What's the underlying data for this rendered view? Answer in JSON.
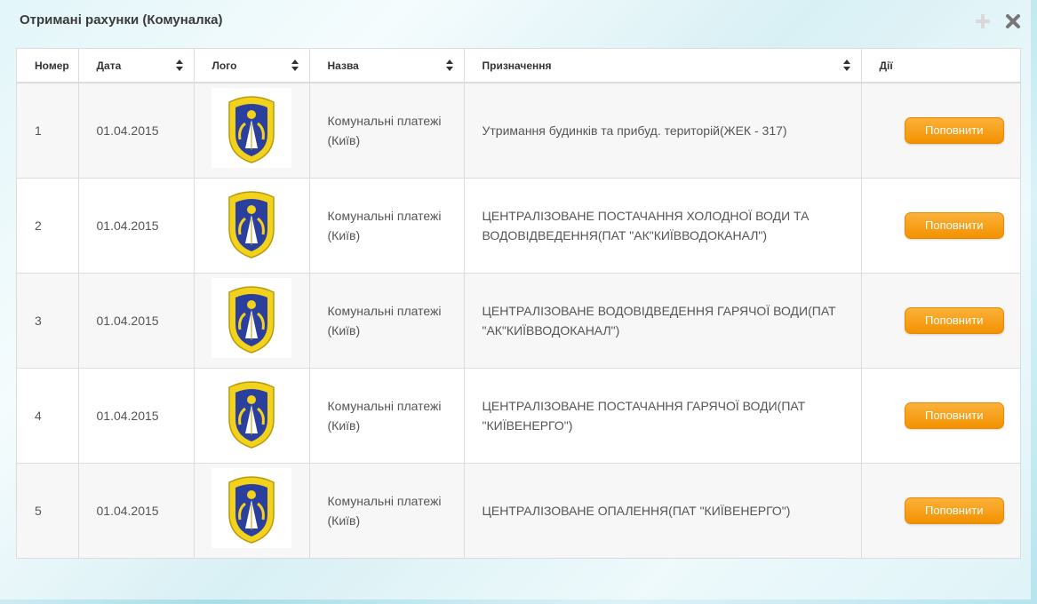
{
  "panel": {
    "title": "Отримані рахунки (Комуналка)",
    "add_icon": "plus-icon",
    "close_icon": "close-icon"
  },
  "table": {
    "headers": {
      "number": "Номер",
      "date": "Дата",
      "logo": "Лого",
      "name": "Назва",
      "purpose": "Призначення",
      "actions": "Дії"
    },
    "rows": [
      {
        "number": "1",
        "date": "01.04.2015",
        "logo": "kyiv-coat-of-arms-icon",
        "name": "Комунальні платежі (Київ)",
        "purpose": "Утримання будинків та прибуд. територій(ЖЕК - 317)",
        "action": "Поповнити"
      },
      {
        "number": "2",
        "date": "01.04.2015",
        "logo": "kyiv-coat-of-arms-icon",
        "name": "Комунальні платежі (Київ)",
        "purpose": "ЦЕНТРАЛІЗОВАНЕ ПОСТАЧАННЯ ХОЛОДНОЇ ВОДИ ТА ВОДОВІДВЕДЕННЯ(ПАТ \"АК\"КИЇВВОДОКАНАЛ\")",
        "action": "Поповнити"
      },
      {
        "number": "3",
        "date": "01.04.2015",
        "logo": "kyiv-coat-of-arms-icon",
        "name": "Комунальні платежі (Київ)",
        "purpose": "ЦЕНТРАЛІЗОВАНЕ ВОДОВІДВЕДЕННЯ ГАРЯЧОЇ ВОДИ(ПАТ \"АК\"КИЇВВОДОКАНАЛ\")",
        "action": "Поповнити"
      },
      {
        "number": "4",
        "date": "01.04.2015",
        "logo": "kyiv-coat-of-arms-icon",
        "name": "Комунальні платежі (Київ)",
        "purpose": "ЦЕНТРАЛІЗОВАНЕ ПОСТАЧАННЯ ГАРЯЧОЇ ВОДИ(ПАТ \"КИЇВЕНЕРГО\")",
        "action": "Поповнити"
      },
      {
        "number": "5",
        "date": "01.04.2015",
        "logo": "kyiv-coat-of-arms-icon",
        "name": "Комунальні платежі (Київ)",
        "purpose": "ЦЕНТРАЛІЗОВАНЕ ОПАЛЕННЯ(ПАТ \"КИЇВЕНЕРГО\")",
        "action": "Поповнити"
      }
    ]
  },
  "colors": {
    "accent_orange": "#f39200",
    "coat_blue": "#2b3f9e",
    "coat_gold": "#f2d21b"
  }
}
